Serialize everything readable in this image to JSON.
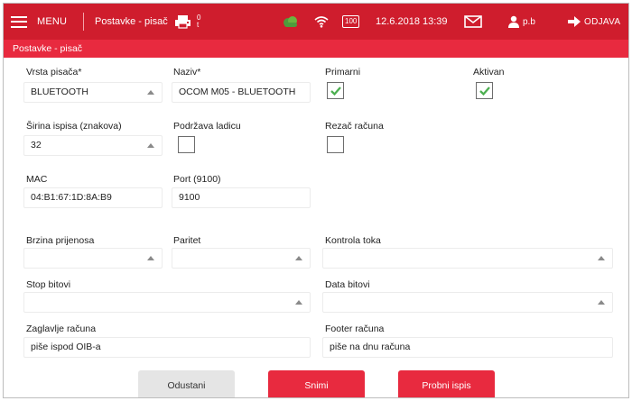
{
  "topbar": {
    "menu_label": "MENU",
    "title": "Postavke - pisač",
    "counter_top": "0",
    "counter_bottom": "t",
    "battery": "100",
    "datetime": "12.6.2018 13:39",
    "user": "p.b",
    "logout_label": "ODJAVA",
    "icons": [
      "hamburger-icon",
      "printer-icon",
      "cloud-icon",
      "wifi-icon",
      "battery-icon",
      "mail-icon",
      "user-icon",
      "logout-arrow-icon"
    ],
    "accent_color": "#cf1d2d"
  },
  "page": {
    "title": "Postavke - pisač",
    "title_color": "#e82a3f"
  },
  "form": {
    "printer_type": {
      "label": "Vrsta pisača*",
      "value": "BLUETOOTH"
    },
    "name": {
      "label": "Naziv*",
      "value": "OCOM M05 - BLUETOOTH"
    },
    "primary": {
      "label": "Primarni",
      "checked": true
    },
    "active": {
      "label": "Aktivan",
      "checked": true
    },
    "print_width": {
      "label": "Širina ispisa (znakova)",
      "value": "32"
    },
    "drawer_support": {
      "label": "Podržava ladicu",
      "checked": false
    },
    "receipt_cutter": {
      "label": "Rezač računa",
      "checked": false
    },
    "mac": {
      "label": "MAC",
      "value": "04:B1:67:1D:8A:B9"
    },
    "port": {
      "label": "Port (9100)",
      "value": "9100"
    },
    "baud_rate": {
      "label": "Brzina prijenosa",
      "value": ""
    },
    "parity": {
      "label": "Paritet",
      "value": ""
    },
    "flow_control": {
      "label": "Kontrola toka",
      "value": ""
    },
    "stop_bits": {
      "label": "Stop bitovi",
      "value": ""
    },
    "data_bits": {
      "label": "Data bitovi",
      "value": ""
    },
    "receipt_header": {
      "label": "Zaglavlje računa",
      "value": "piše ispod OIB-a"
    },
    "receipt_footer": {
      "label": "Footer računa",
      "value": "piše na dnu računa"
    }
  },
  "buttons": {
    "cancel": "Odustani",
    "save": "Snimi",
    "test_print": "Probni ispis"
  }
}
